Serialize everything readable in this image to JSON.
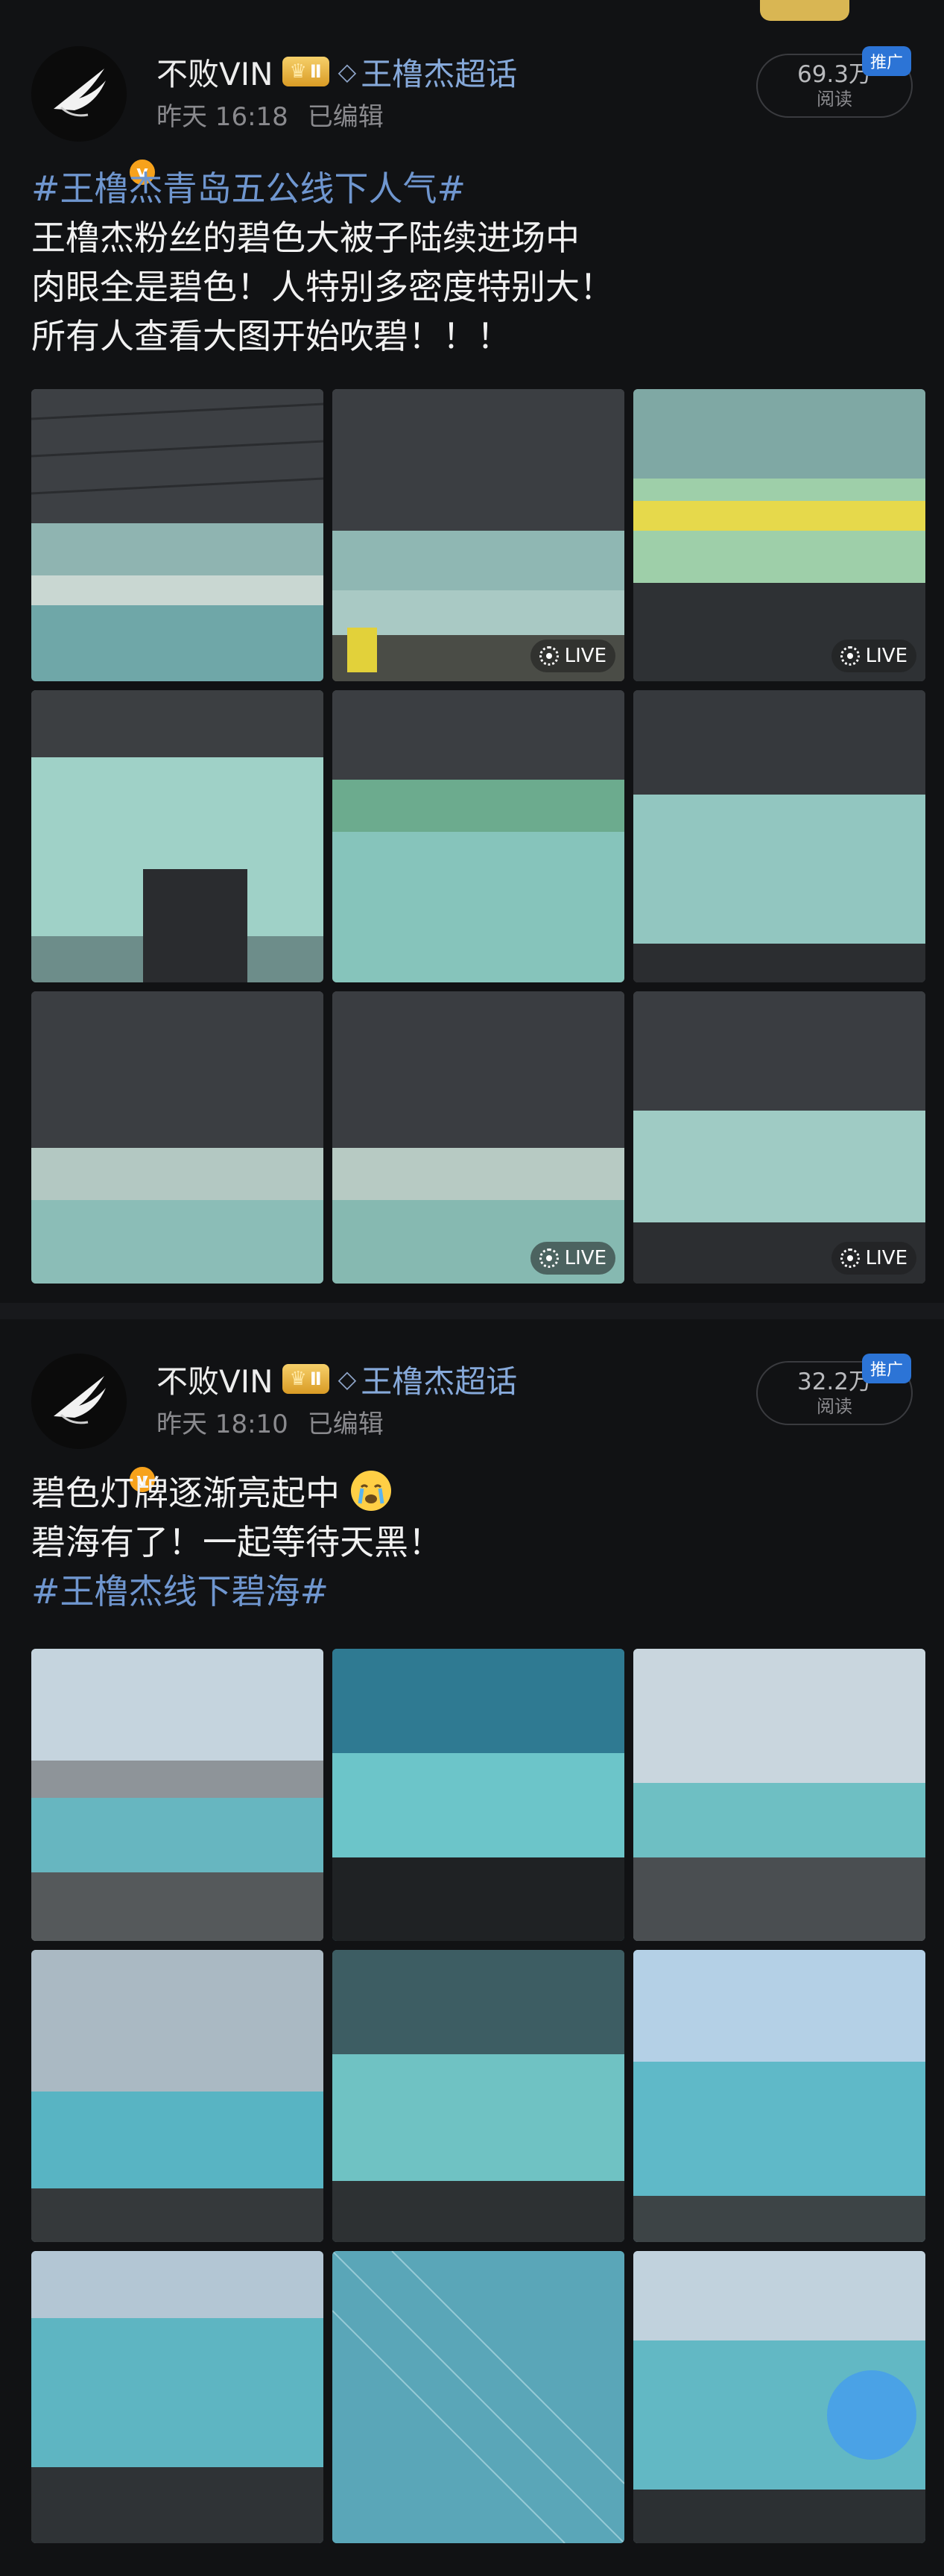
{
  "posts": [
    {
      "author": "不败VIN",
      "level_badge": "Ⅱ",
      "verified_mark": "v",
      "topic": "王橹杰超话",
      "time": "昨天 16:18",
      "edited": "已编辑",
      "views": "69.3万",
      "views_label": "阅读",
      "promo": "推广",
      "hashtag": "#王橹杰青岛五公线下人气#",
      "lines": [
        "王橹杰粉丝的碧色大被子陆续进场中",
        "肉眼全是碧色！人特别多密度特别大！",
        "所有人查看大图开始吹碧！！！"
      ],
      "live_label": "LIVE",
      "image_count": 9,
      "live_tiles": [
        1,
        2,
        7,
        8
      ]
    },
    {
      "author": "不败VIN",
      "level_badge": "Ⅱ",
      "verified_mark": "v",
      "topic": "王橹杰超话",
      "time": "昨天 18:10",
      "edited": "已编辑",
      "views": "32.2万",
      "views_label": "阅读",
      "promo": "推广",
      "lines": [
        "碧色灯牌逐渐亮起中",
        "碧海有了！一起等待天黑！"
      ],
      "hashtag": "#王橹杰线下碧海#",
      "image_count": 9
    }
  ],
  "icons": {
    "crown": "crown-icon",
    "diamond": "diamond-icon",
    "live": "live-photo-icon",
    "emoji": "crying-face-emoji"
  },
  "colors": {
    "background": "#111214",
    "hashtag": "#6f96cf",
    "topic": "#86a9da",
    "promo": "#2c74d6",
    "verified": "#f7a21b"
  }
}
